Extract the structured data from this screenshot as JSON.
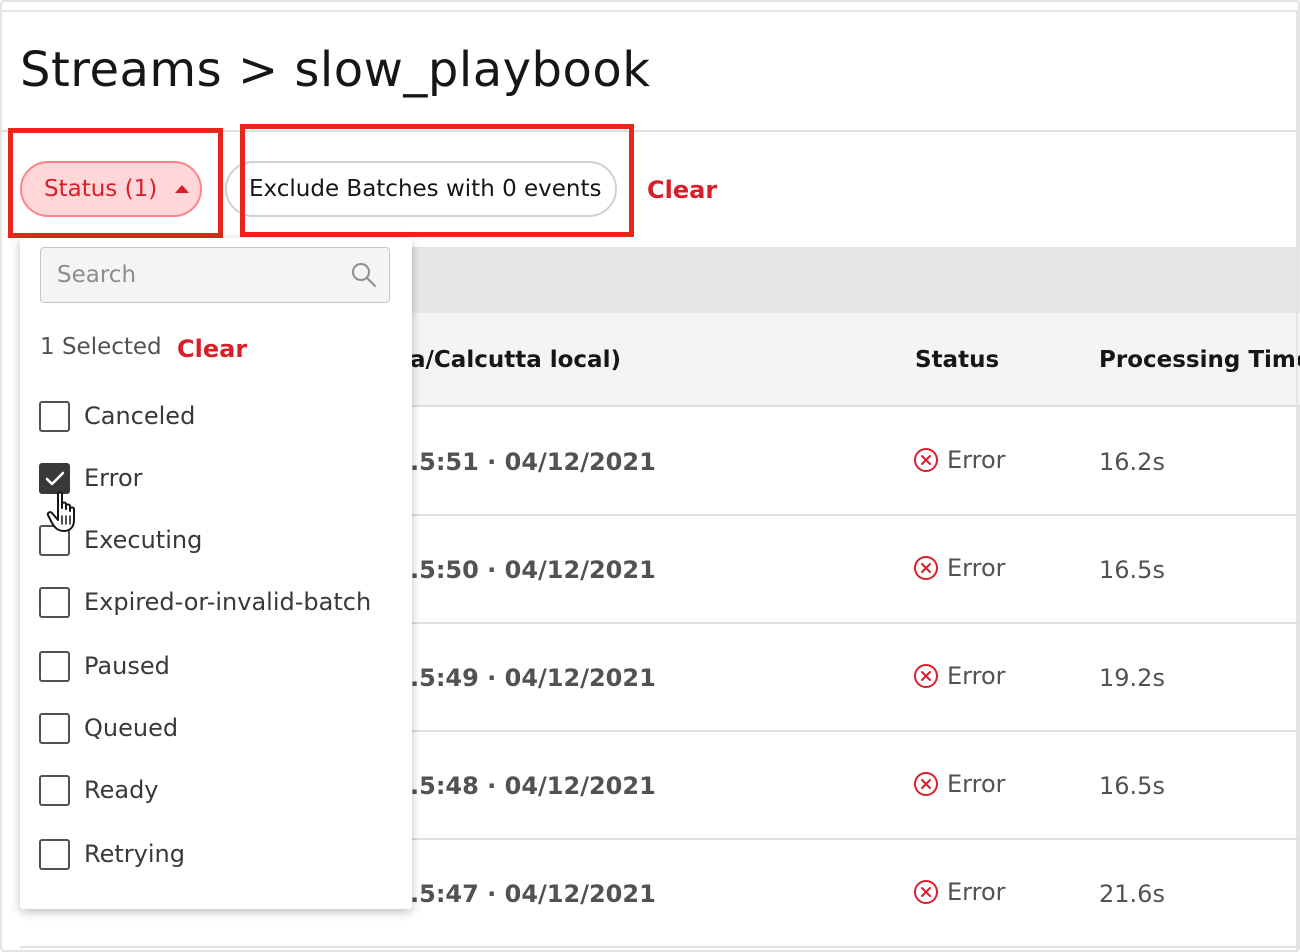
{
  "page": {
    "title": "Streams > slow_playbook"
  },
  "filters": {
    "status_chip_label": "Status (1)",
    "exclude_chip_label": "Exclude Batches with 0 events",
    "clear_label": "Clear"
  },
  "table": {
    "columns": {
      "time": "a/Calcutta local)",
      "status": "Status",
      "processing_time": "Processing Time"
    },
    "rows": [
      {
        "time": ".5:51 · 04/12/2021",
        "status": "Error",
        "processing_time": "16.2s"
      },
      {
        "time": ".5:50 · 04/12/2021",
        "status": "Error",
        "processing_time": "16.5s"
      },
      {
        "time": ".5:49 · 04/12/2021",
        "status": "Error",
        "processing_time": "19.2s"
      },
      {
        "time": ".5:48 · 04/12/2021",
        "status": "Error",
        "processing_time": "16.5s"
      },
      {
        "time": ".5:47 · 04/12/2021",
        "status": "Error",
        "processing_time": "21.6s"
      }
    ]
  },
  "dropdown": {
    "search_placeholder": "Search",
    "selected_count": "1 Selected",
    "clear_label": "Clear",
    "options": [
      {
        "label": "Canceled",
        "checked": false
      },
      {
        "label": "Error",
        "checked": true
      },
      {
        "label": "Executing",
        "checked": false
      },
      {
        "label": "Expired-or-invalid-batch",
        "checked": false
      },
      {
        "label": "Paused",
        "checked": false
      },
      {
        "label": "Queued",
        "checked": false
      },
      {
        "label": "Ready",
        "checked": false
      },
      {
        "label": "Retrying",
        "checked": false
      }
    ]
  },
  "colors": {
    "accent_red": "#da1e28",
    "chip_bg": "#ffd7d9",
    "highlight_box": "#e8271c",
    "checkbox_checked": "#393939"
  }
}
